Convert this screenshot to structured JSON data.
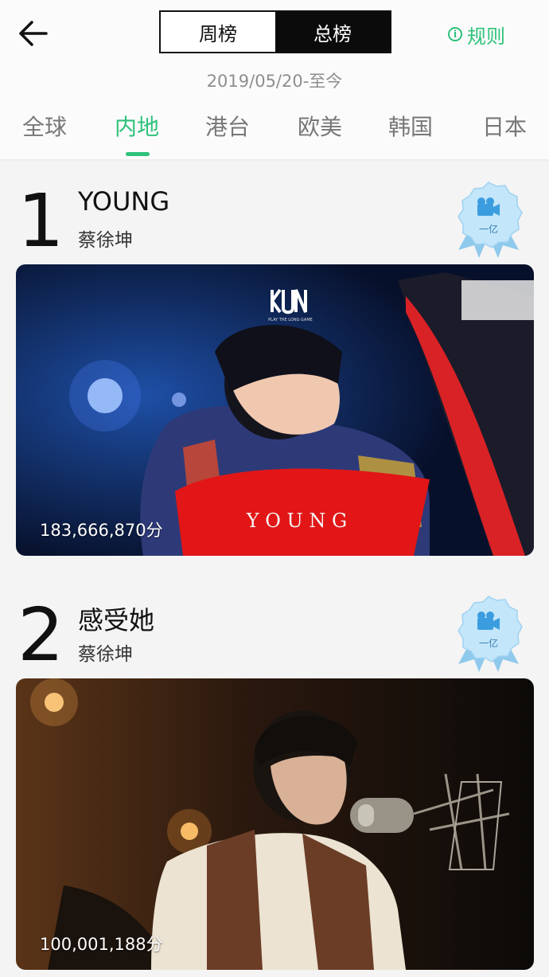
{
  "header": {
    "segments": [
      {
        "label": "周榜",
        "active": false
      },
      {
        "label": "总榜",
        "active": true
      }
    ],
    "rules_label": "规则",
    "date_range": "2019/05/20-至今"
  },
  "tabs": [
    {
      "label": "全球",
      "active": false
    },
    {
      "label": "内地",
      "active": true
    },
    {
      "label": "港台",
      "active": false
    },
    {
      "label": "欧美",
      "active": false
    },
    {
      "label": "韩国",
      "active": false
    },
    {
      "label": "日本",
      "active": false
    }
  ],
  "entries": [
    {
      "rank": "1",
      "title": "YOUNG",
      "artist": "蔡徐坤",
      "badge": "一亿",
      "score": "183,666,870分",
      "cover_logo": "KUN",
      "cover_sub": "PLAY THE LONG GAME",
      "cover_text": "Y O U N G"
    },
    {
      "rank": "2",
      "title": "感受她",
      "artist": "蔡徐坤",
      "badge": "一亿",
      "score": "100,001,188分"
    }
  ],
  "colors": {
    "accent": "#2ec27a",
    "badge": "#bfe3f7"
  },
  "icons": {
    "back": "arrow-left-icon",
    "rules": "info-icon",
    "badge": "video-medal-icon"
  }
}
